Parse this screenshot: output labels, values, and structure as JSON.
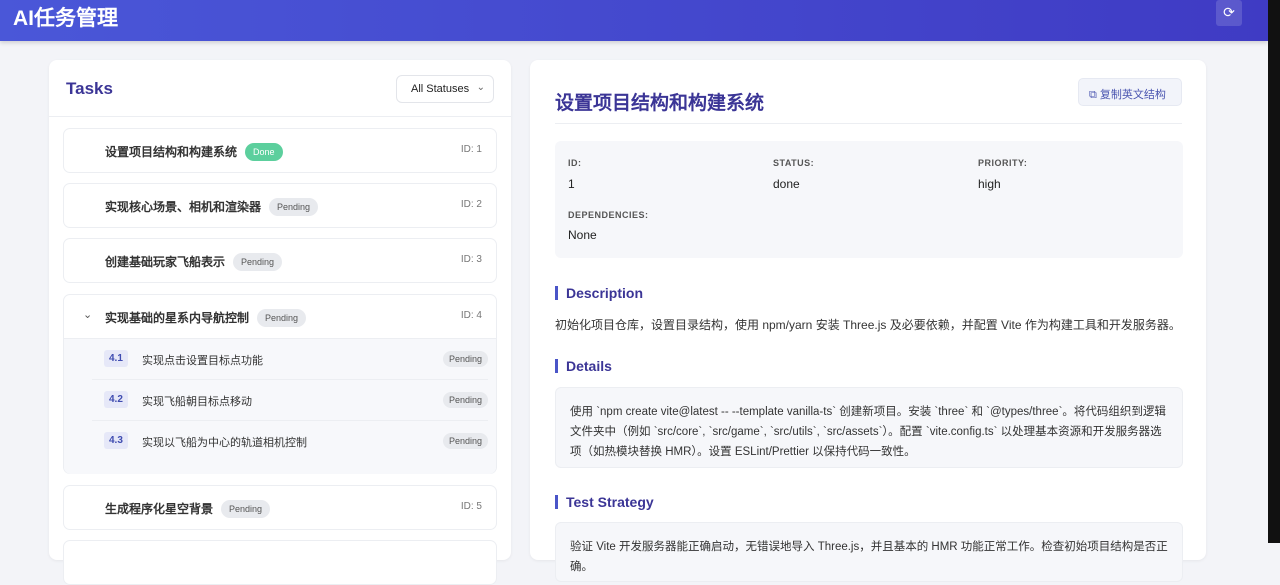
{
  "header": {
    "title": "AI任务管理",
    "refresh_icon": "refresh-icon"
  },
  "tasks_panel": {
    "title": "Tasks",
    "filter": "All Statuses",
    "tasks": [
      {
        "name": "设置项目结构和构建系统",
        "status": "Done",
        "id": "ID: 1"
      },
      {
        "name": "实现核心场景、相机和渲染器",
        "status": "Pending",
        "id": "ID: 2"
      },
      {
        "name": "创建基础玩家飞船表示",
        "status": "Pending",
        "id": "ID: 3"
      },
      {
        "name": "实现基础的星系内导航控制",
        "status": "Pending",
        "id": "ID: 4",
        "subtasks": [
          {
            "num": "4.1",
            "name": "实现点击设置目标点功能",
            "status": "Pending"
          },
          {
            "num": "4.2",
            "name": "实现飞船朝目标点移动",
            "status": "Pending"
          },
          {
            "num": "4.3",
            "name": "实现以飞船为中心的轨道相机控制",
            "status": "Pending"
          }
        ]
      },
      {
        "name": "生成程序化星空背景",
        "status": "Pending",
        "id": "ID: 5"
      }
    ]
  },
  "detail": {
    "title": "设置项目结构和构建系统",
    "copy_button": "复制英文结构",
    "meta": {
      "id_label": "ID:",
      "id": "1",
      "status_label": "STATUS:",
      "status": "done",
      "priority_label": "PRIORITY:",
      "priority": "high",
      "deps_label": "DEPENDENCIES:",
      "deps": "None"
    },
    "description_title": "Description",
    "description": "初始化项目仓库，设置目录结构，使用 npm/yarn 安装 Three.js 及必要依赖，并配置 Vite 作为构建工具和开发服务器。",
    "details_title": "Details",
    "details": "使用 `npm create vite@latest -- --template vanilla-ts` 创建新项目。安装 `three` 和 `@types/three`。将代码组织到逻辑文件夹中（例如 `src/core`, `src/game`, `src/utils`, `src/assets`）。配置 `vite.config.ts` 以处理基本资源和开发服务器选项（如热模块替换 HMR）。设置 ESLint/Prettier 以保持代码一致性。",
    "test_title": "Test Strategy",
    "test": "验证 Vite 开发服务器能正确启动，无错误地导入 Three.js，并且基本的 HMR 功能正常工作。检查初始项目结构是否正确。"
  }
}
